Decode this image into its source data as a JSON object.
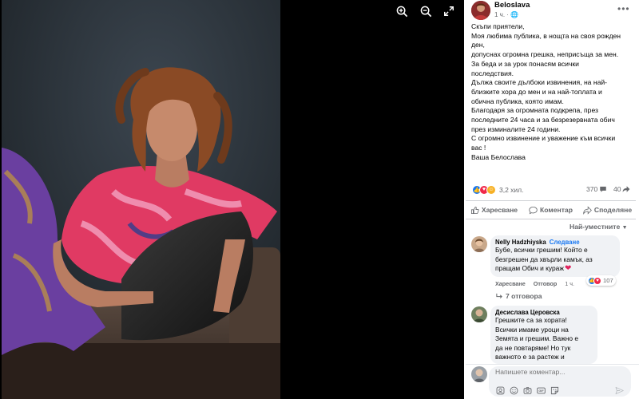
{
  "author": {
    "name": "Beloslava",
    "time": "1 ч."
  },
  "post": {
    "lines": [
      "Скъпи приятели,",
      "Моя любима публика, в нощта на своя рожден",
      "ден,",
      "допуснах огромна грешка, неприсъща за мен.",
      "За беда и за урок понасям всички",
      "последствия.",
      "Дължа своите дълбоки извинения, на най-",
      "близките хора до мен и на най-топлата и",
      "обична публика, която имам.",
      "Благодаря за огромната подкрепа, през",
      "последните 24 часа и за безрезервната обич",
      "през изминалите 24 години.",
      "С огромно извинение и уважение към всички",
      "вас !",
      "Ваша Белослава"
    ]
  },
  "stats": {
    "reactions": "3,2 хил.",
    "comments": "370",
    "shares": "40"
  },
  "actions": {
    "like": "Харесване",
    "comment": "Коментар",
    "share": "Споделяне"
  },
  "sort_label": "Най-уместните",
  "comments": [
    {
      "name": "Nelly Hadzhiyska",
      "follow": "Следване",
      "lines": [
        "Бубе, всички грешим! Който е",
        "безгрешен да хвърли камък, аз",
        "пращам Обич и кураж"
      ],
      "like": "Харесване",
      "reply": "Отговор",
      "time": "1 ч.",
      "reaction_count": "107",
      "replies": "7 отговора"
    },
    {
      "name": "Десислава Церовска",
      "lines": [
        "Грешките са за хората!",
        "Всички имаме уроци на",
        "Земята и грешим. Важно е",
        "да не повтаряме! Но тук",
        "важното е за растеж и"
      ]
    }
  ],
  "composer": {
    "placeholder": "Напишете коментар..."
  },
  "colors": {
    "link": "#1877f2",
    "like": "#1877f2",
    "love": "#f02849",
    "care": "#f7b125",
    "muted": "#65676b"
  },
  "icons": {
    "zoom_in": "zoom-in-icon",
    "zoom_out": "zoom-out-icon",
    "fullscreen": "fullscreen-icon"
  }
}
